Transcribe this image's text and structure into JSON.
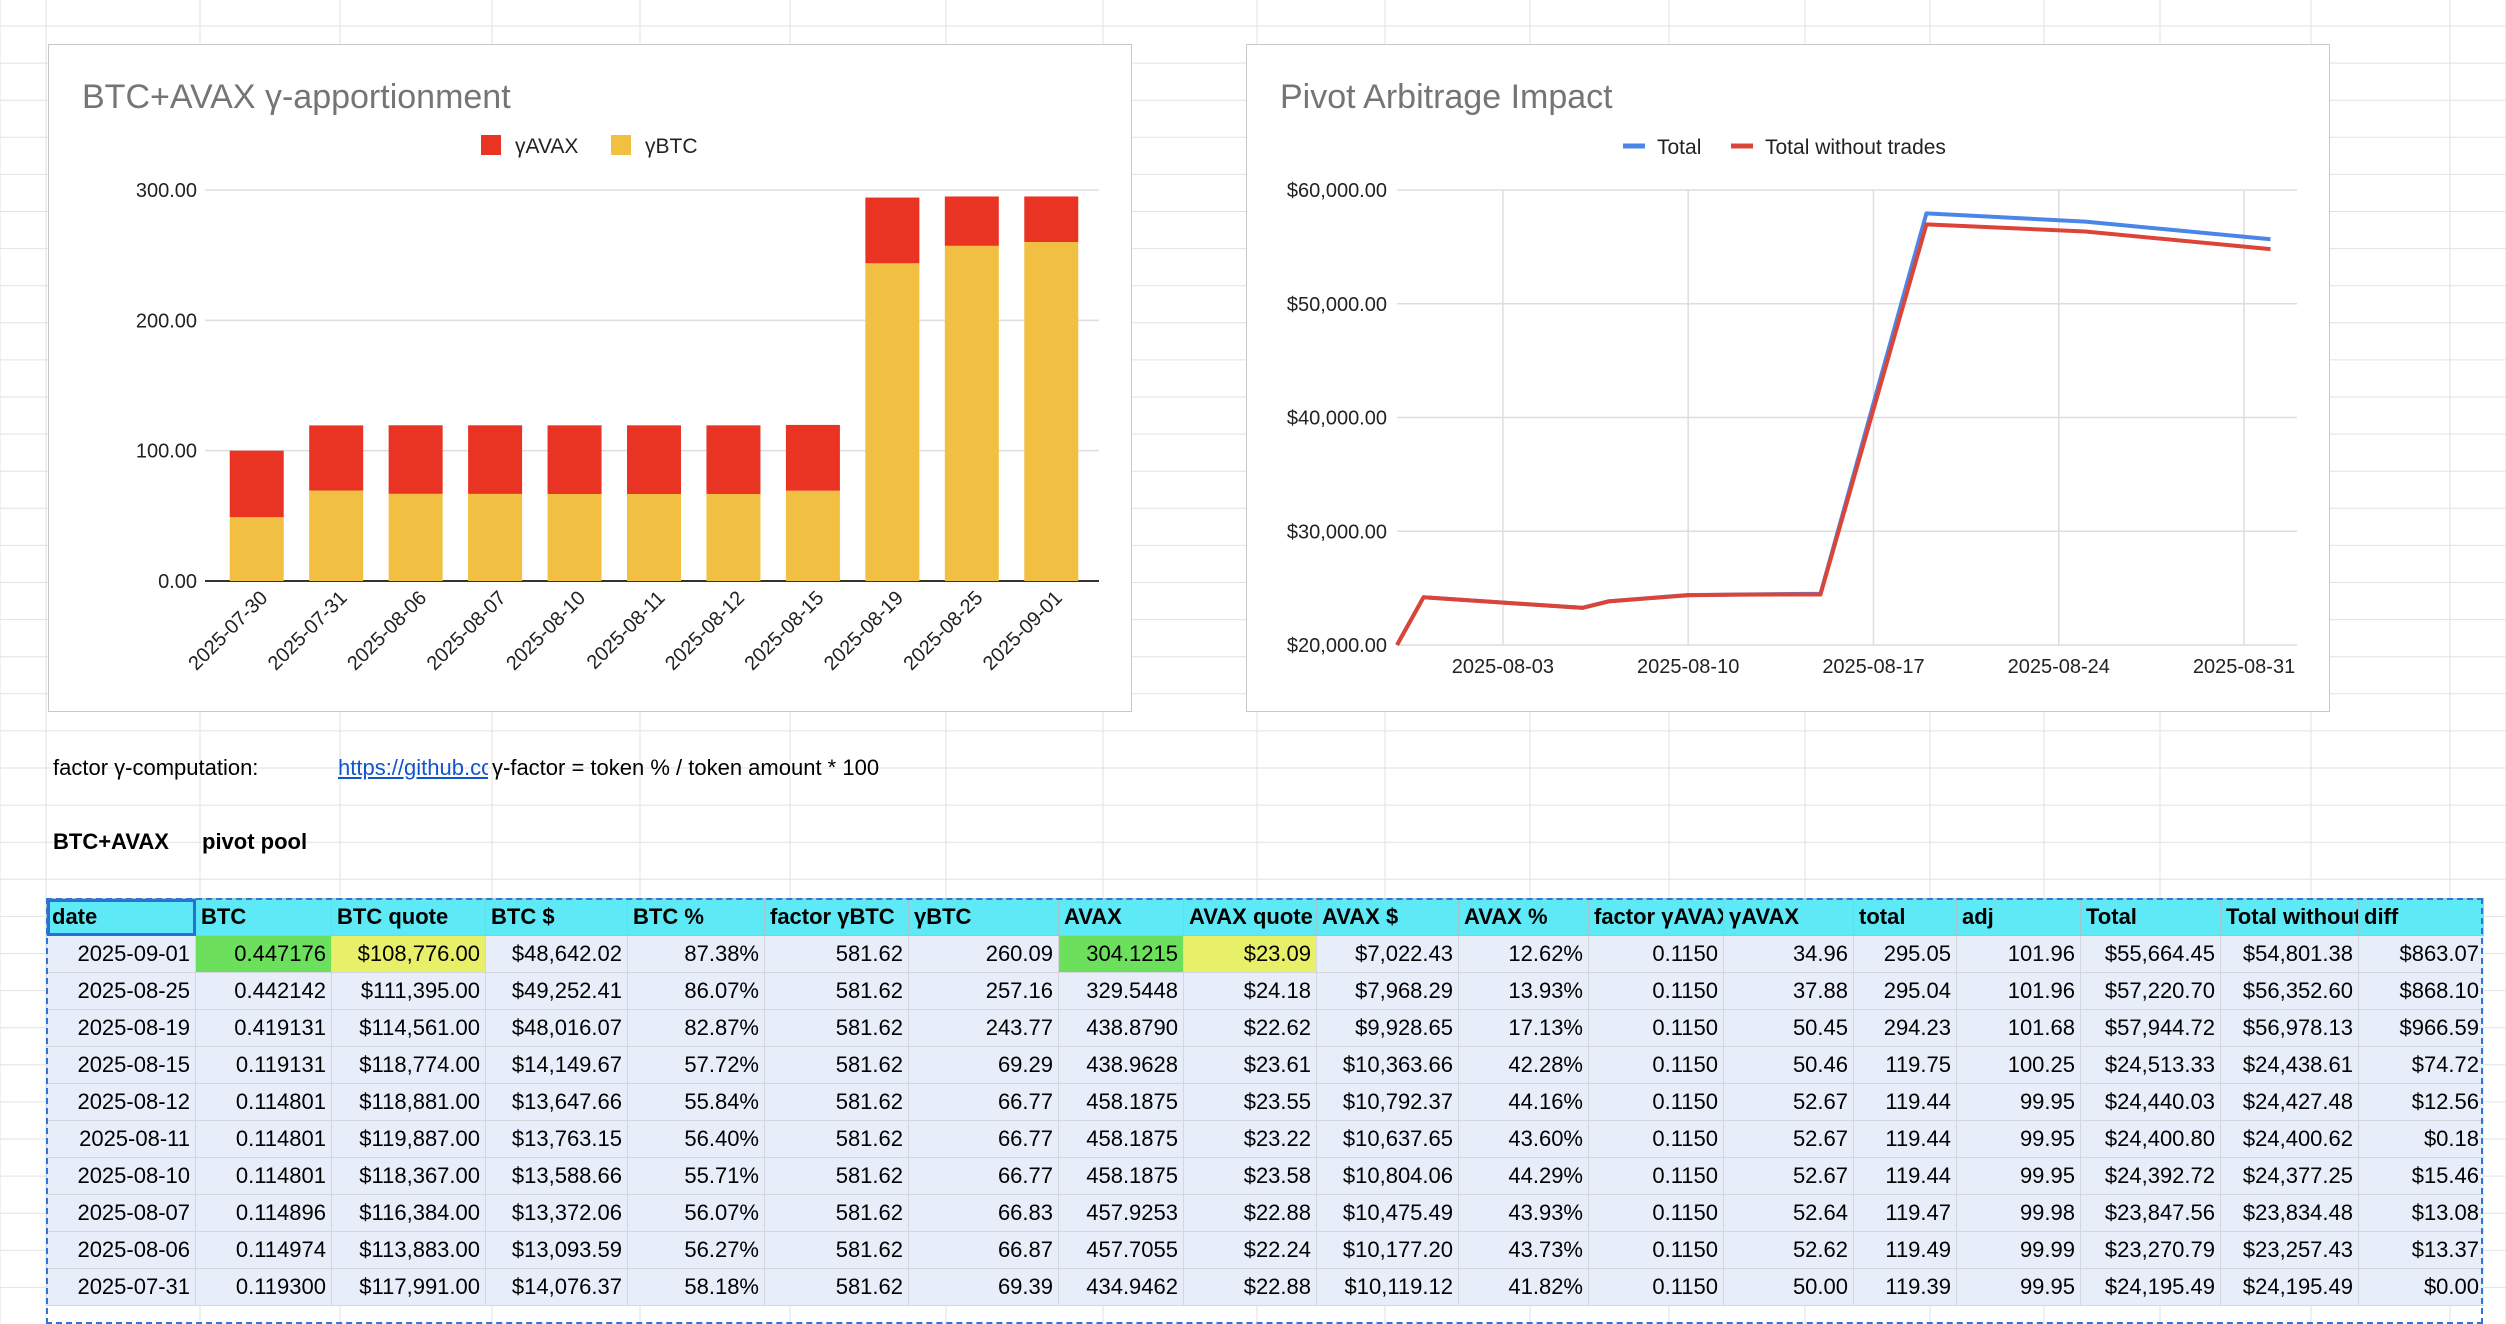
{
  "chart1": {
    "chart_data": {
      "type": "bar",
      "stacked": true,
      "title": "BTC+AVAX γ-apportionment",
      "categories": [
        "2025-07-30",
        "2025-07-31",
        "2025-08-06",
        "2025-08-07",
        "2025-08-10",
        "2025-08-11",
        "2025-08-12",
        "2025-08-15",
        "2025-08-19",
        "2025-08-25",
        "2025-09-01"
      ],
      "series": [
        {
          "name": "γBTC",
          "color": "#f1bf42",
          "values": [
            49,
            69.39,
            66.87,
            66.83,
            66.77,
            66.77,
            66.77,
            69.29,
            243.77,
            257.16,
            260.09
          ]
        },
        {
          "name": "γAVAX",
          "color": "#ea3423",
          "values": [
            51,
            50.0,
            52.62,
            52.64,
            52.67,
            52.67,
            52.67,
            50.46,
            50.45,
            37.88,
            34.96
          ]
        }
      ],
      "legend_order": [
        "γAVAX",
        "γBTC"
      ],
      "yticks": [
        "300.00",
        "200.00",
        "100.00",
        "0.00"
      ],
      "ylim": [
        0,
        300
      ],
      "legend_position": "top"
    }
  },
  "chart2": {
    "chart_data": {
      "type": "line",
      "title": "Pivot Arbitrage Impact",
      "x": [
        "2025-07-30",
        "2025-07-31",
        "2025-08-06",
        "2025-08-07",
        "2025-08-10",
        "2025-08-11",
        "2025-08-12",
        "2025-08-15",
        "2025-08-19",
        "2025-08-25",
        "2025-09-01"
      ],
      "series": [
        {
          "name": "Total",
          "color": "#4a86e8",
          "values": [
            20000,
            24195.49,
            23270.79,
            23847.56,
            24392.72,
            24400.8,
            24440.03,
            24513.33,
            57944.72,
            57220.7,
            55664.45
          ]
        },
        {
          "name": "Total without trades",
          "color": "#db4437",
          "values": [
            20000,
            24195.49,
            23257.43,
            23834.48,
            24377.25,
            24400.62,
            24427.48,
            24438.61,
            56978.13,
            56352.6,
            54801.38
          ]
        }
      ],
      "xticks": [
        "2025-08-03",
        "2025-08-10",
        "2025-08-17",
        "2025-08-24",
        "2025-08-31"
      ],
      "yticks": [
        "$60,000.00",
        "$50,000.00",
        "$40,000.00",
        "$30,000.00",
        "$20,000.00"
      ],
      "ylim": [
        20000,
        60000
      ],
      "legend_position": "top"
    }
  },
  "notes": {
    "factor_label": "factor γ-computation:",
    "link_text": "https://github.com",
    "formula": "γ-factor = token % / token amount * 100",
    "pool_name": "BTC+AVAX",
    "pool_type": "pivot pool"
  },
  "table": {
    "headers": [
      "date",
      "BTC",
      "BTC quote",
      "BTC $",
      "BTC %",
      "factor γBTC",
      "γBTC",
      "AVAX",
      "AVAX quote",
      "AVAX $",
      "AVAX %",
      "factor γAVAX",
      "γAVAX",
      "total",
      "adj",
      "Total",
      "Total without trades",
      "diff"
    ],
    "rows": [
      [
        "2025-09-01",
        "0.447176",
        "$108,776.00",
        "$48,642.02",
        "87.38%",
        "581.62",
        "260.09",
        "304.1215",
        "$23.09",
        "$7,022.43",
        "12.62%",
        "0.1150",
        "34.96",
        "295.05",
        "101.96",
        "$55,664.45",
        "$54,801.38",
        "$863.07"
      ],
      [
        "2025-08-25",
        "0.442142",
        "$111,395.00",
        "$49,252.41",
        "86.07%",
        "581.62",
        "257.16",
        "329.5448",
        "$24.18",
        "$7,968.29",
        "13.93%",
        "0.1150",
        "37.88",
        "295.04",
        "101.96",
        "$57,220.70",
        "$56,352.60",
        "$868.10"
      ],
      [
        "2025-08-19",
        "0.419131",
        "$114,561.00",
        "$48,016.07",
        "82.87%",
        "581.62",
        "243.77",
        "438.8790",
        "$22.62",
        "$9,928.65",
        "17.13%",
        "0.1150",
        "50.45",
        "294.23",
        "101.68",
        "$57,944.72",
        "$56,978.13",
        "$966.59"
      ],
      [
        "2025-08-15",
        "0.119131",
        "$118,774.00",
        "$14,149.67",
        "57.72%",
        "581.62",
        "69.29",
        "438.9628",
        "$23.61",
        "$10,363.66",
        "42.28%",
        "0.1150",
        "50.46",
        "119.75",
        "100.25",
        "$24,513.33",
        "$24,438.61",
        "$74.72"
      ],
      [
        "2025-08-12",
        "0.114801",
        "$118,881.00",
        "$13,647.66",
        "55.84%",
        "581.62",
        "66.77",
        "458.1875",
        "$23.55",
        "$10,792.37",
        "44.16%",
        "0.1150",
        "52.67",
        "119.44",
        "99.95",
        "$24,440.03",
        "$24,427.48",
        "$12.56"
      ],
      [
        "2025-08-11",
        "0.114801",
        "$119,887.00",
        "$13,763.15",
        "56.40%",
        "581.62",
        "66.77",
        "458.1875",
        "$23.22",
        "$10,637.65",
        "43.60%",
        "0.1150",
        "52.67",
        "119.44",
        "99.95",
        "$24,400.80",
        "$24,400.62",
        "$0.18"
      ],
      [
        "2025-08-10",
        "0.114801",
        "$118,367.00",
        "$13,588.66",
        "55.71%",
        "581.62",
        "66.77",
        "458.1875",
        "$23.58",
        "$10,804.06",
        "44.29%",
        "0.1150",
        "52.67",
        "119.44",
        "99.95",
        "$24,392.72",
        "$24,377.25",
        "$15.46"
      ],
      [
        "2025-08-07",
        "0.114896",
        "$116,384.00",
        "$13,372.06",
        "56.07%",
        "581.62",
        "66.83",
        "457.9253",
        "$22.88",
        "$10,475.49",
        "43.93%",
        "0.1150",
        "52.64",
        "119.47",
        "99.98",
        "$23,847.56",
        "$23,834.48",
        "$13.08"
      ],
      [
        "2025-08-06",
        "0.114974",
        "$113,883.00",
        "$13,093.59",
        "56.27%",
        "581.62",
        "66.87",
        "457.7055",
        "$22.24",
        "$10,177.20",
        "43.73%",
        "0.1150",
        "52.62",
        "119.49",
        "99.99",
        "$23,270.79",
        "$23,257.43",
        "$13.37"
      ],
      [
        "2025-07-31",
        "0.119300",
        "$117,991.00",
        "$14,076.37",
        "58.18%",
        "581.62",
        "69.39",
        "434.9462",
        "$22.88",
        "$10,119.12",
        "41.82%",
        "0.1150",
        "50.00",
        "119.39",
        "99.95",
        "$24,195.49",
        "$24,195.49",
        "$0.00"
      ]
    ]
  }
}
